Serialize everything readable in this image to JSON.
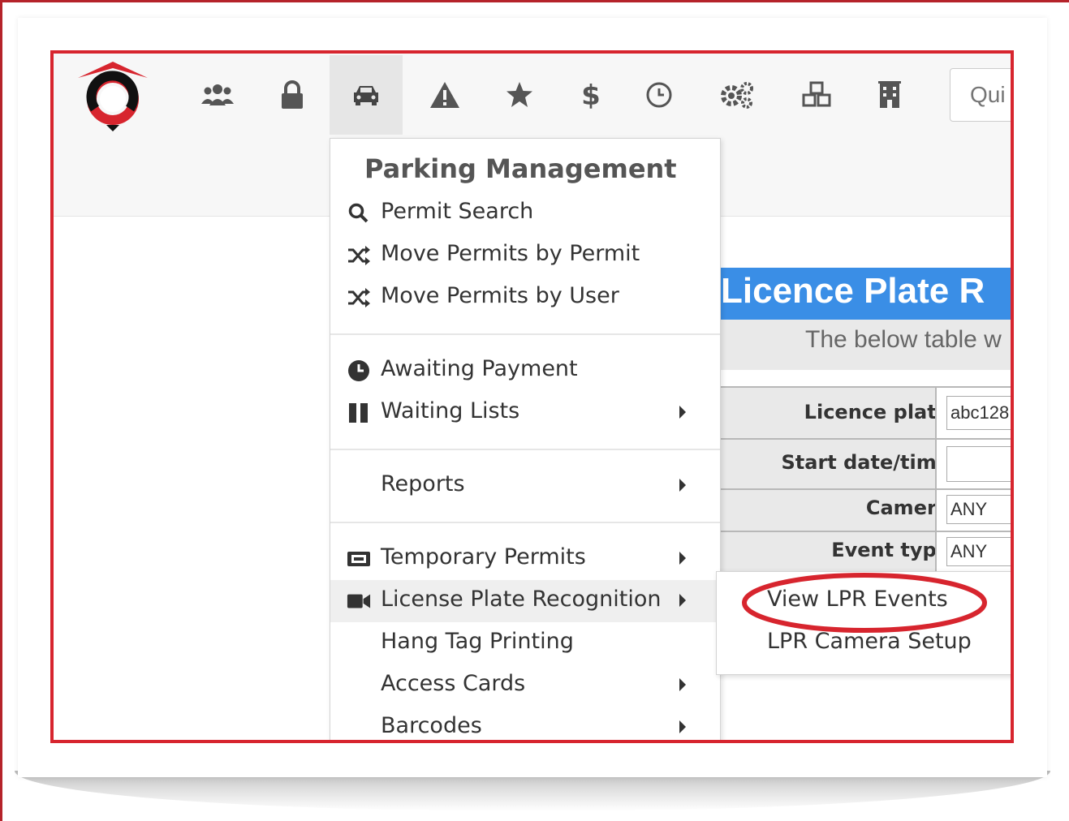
{
  "quick_search": {
    "placeholder": "Qui"
  },
  "nav": {
    "icons": [
      "logo-icon",
      "users-icon",
      "lock-icon",
      "car-icon",
      "warning-icon",
      "star-icon",
      "dollar-icon",
      "clock-icon",
      "gears-icon",
      "cubes-icon",
      "building-icon"
    ],
    "active": "car-icon"
  },
  "dropdown": {
    "header": "Parking Management",
    "items": [
      {
        "label": "Permit Search",
        "icon": "search-icon"
      },
      {
        "label": "Move Permits by Permit",
        "icon": "shuffle-icon"
      },
      {
        "label": "Move Permits by User",
        "icon": "shuffle-icon"
      },
      {
        "label": "Awaiting Payment",
        "icon": "clock-icon"
      },
      {
        "label": "Waiting Lists",
        "icon": "pause-icon",
        "submenu": true
      },
      {
        "label": "Reports",
        "submenu": true
      },
      {
        "label": "Temporary Permits",
        "icon": "ticket-icon",
        "submenu": true
      },
      {
        "label": "License Plate Recognition",
        "icon": "video-camera-icon",
        "submenu": true,
        "active": true
      },
      {
        "label": "Hang Tag Printing"
      },
      {
        "label": "Access Cards",
        "submenu": true
      },
      {
        "label": "Barcodes",
        "submenu": true
      }
    ]
  },
  "submenu": {
    "items": [
      {
        "label": "View LPR Events",
        "highlighted": true
      },
      {
        "label": "LPR Camera Setup"
      }
    ]
  },
  "lpr_panel": {
    "title": "Licence Plate R",
    "subtitle": "The below table w",
    "fields": [
      {
        "label": "Licence plate",
        "value": "abc128"
      },
      {
        "label": "Start date/time",
        "value": ""
      },
      {
        "label": "Camera",
        "value": "ANY"
      },
      {
        "label": "Event type",
        "value": "ANY"
      }
    ]
  },
  "colors": {
    "frame_red": "#d7252e",
    "highlight_red": "#d7252e",
    "banner_blue": "#3a8ee6",
    "logo_red": "#d7252e"
  }
}
